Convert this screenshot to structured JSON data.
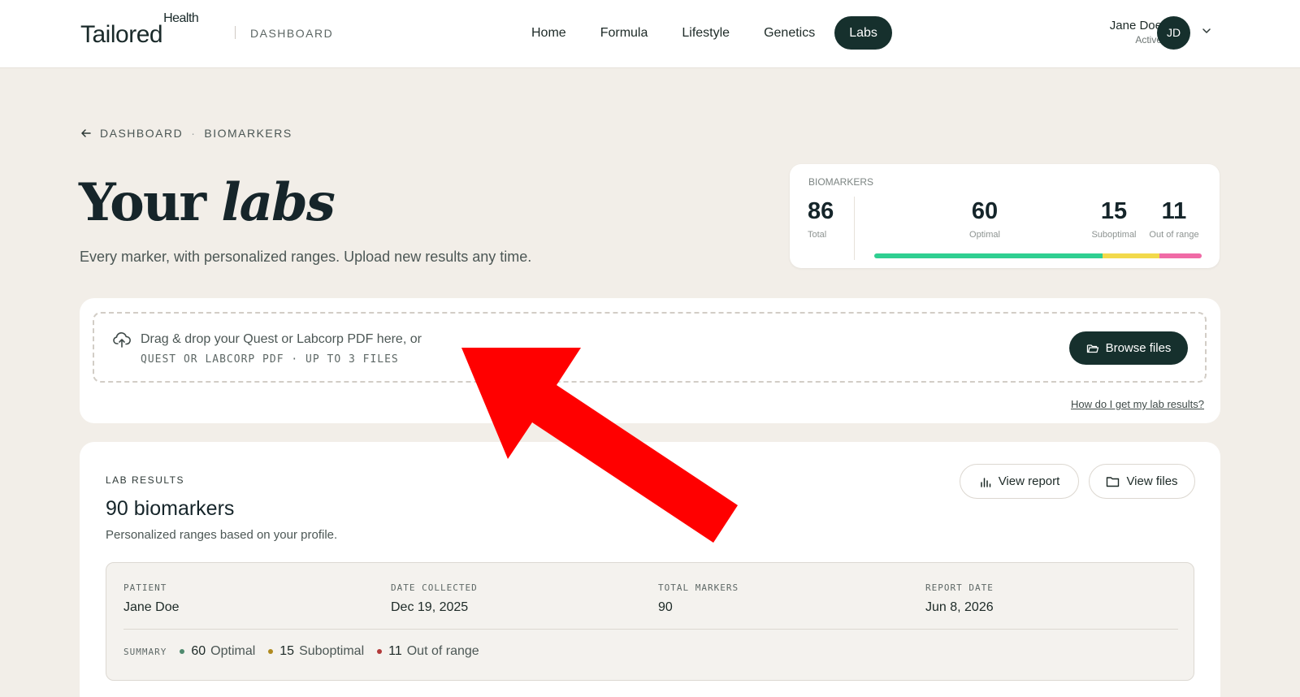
{
  "header": {
    "logo_main": "Tailored",
    "logo_super": "Health",
    "section": "DASHBOARD",
    "nav": [
      {
        "label": "Home",
        "active": false
      },
      {
        "label": "Formula",
        "active": false
      },
      {
        "label": "Lifestyle",
        "active": false
      },
      {
        "label": "Genetics",
        "active": false
      },
      {
        "label": "Labs",
        "active": true
      }
    ],
    "user": {
      "name": "Jane Doe",
      "status": "Active",
      "initials": "JD"
    }
  },
  "breadcrumb": {
    "parent": "DASHBOARD",
    "separator": "·",
    "current": "BIOMARKERS"
  },
  "page": {
    "title_plain": "Your",
    "title_italic": "labs",
    "subtitle": "Every marker, with personalized ranges. Upload new results any time."
  },
  "biomarkers": {
    "label": "BIOMARKERS",
    "total": {
      "value": "86",
      "caption": "Total"
    },
    "optimal": {
      "value": "60",
      "caption": "Optimal"
    },
    "suboptimal": {
      "value": "15",
      "caption": "Suboptimal"
    },
    "out_of_range": {
      "value": "11",
      "caption": "Out of range"
    },
    "bar_segments": [
      {
        "name": "Optimal",
        "fraction": 0.698,
        "color": "#2fcf91"
      },
      {
        "name": "Suboptimal",
        "fraction": 0.174,
        "color": "#f2d94b"
      },
      {
        "name": "Out of range",
        "fraction": 0.128,
        "color": "#f06aa6"
      }
    ]
  },
  "upload": {
    "line1": "Drag & drop your Quest or Labcorp PDF here, or",
    "line2": "QUEST OR LABCORP PDF · UP TO 3 FILES",
    "browse_label": "Browse files",
    "help_link": "How do I get my lab results?"
  },
  "results": {
    "label": "LAB RESULTS",
    "title": "90 biomarkers",
    "subtitle": "Personalized ranges based on your profile.",
    "view_report_label": "View report",
    "view_files_label": "View files",
    "info": [
      {
        "key": "PATIENT",
        "value": "Jane Doe"
      },
      {
        "key": "DATE COLLECTED",
        "value": "Dec 19, 2025"
      },
      {
        "key": "TOTAL MARKERS",
        "value": "90"
      },
      {
        "key": "REPORT DATE",
        "value": "Jun 8, 2026"
      }
    ],
    "summary_label": "SUMMARY",
    "summary": [
      {
        "count": "60",
        "label": "Optimal",
        "color": "#4f8a6e"
      },
      {
        "count": "15",
        "label": "Suboptimal",
        "color": "#b08a1f"
      },
      {
        "count": "11",
        "label": "Out of range",
        "color": "#b23a3a"
      }
    ]
  },
  "colors": {
    "accent": "#16302d",
    "background": "#f2eee8",
    "annotation_arrow": "#ff0000"
  }
}
